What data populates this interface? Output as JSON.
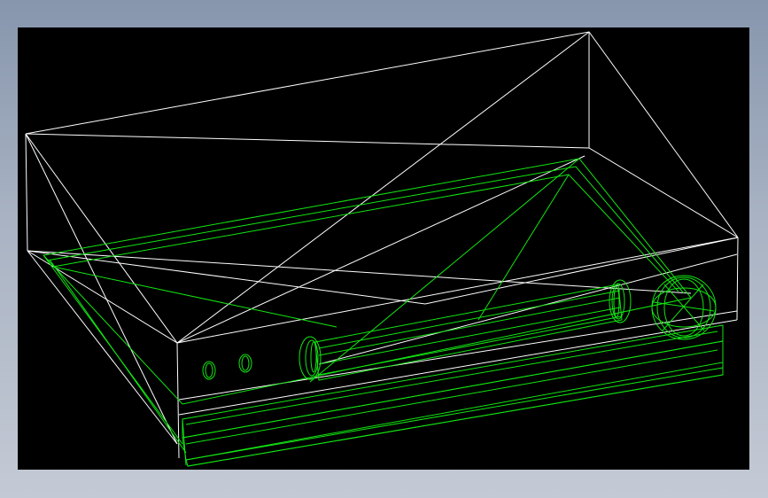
{
  "scene": {
    "background_gradient": [
      "#8796ad",
      "#c4cad5"
    ],
    "viewport_color": "#000000",
    "bounding_wireframe_color": "#ffffff",
    "model_wireframe_color": "#12e612",
    "display_mode": "wireframe",
    "model": "dvd-player-housing",
    "features": [
      "bounding-box-outline",
      "housing-body",
      "front-panel",
      "disc-tray-slot",
      "tray-end-cap-left",
      "tray-end-cap-right",
      "round-control-knob",
      "indicator-button-1",
      "indicator-button-2",
      "bottom-base-plate"
    ]
  }
}
